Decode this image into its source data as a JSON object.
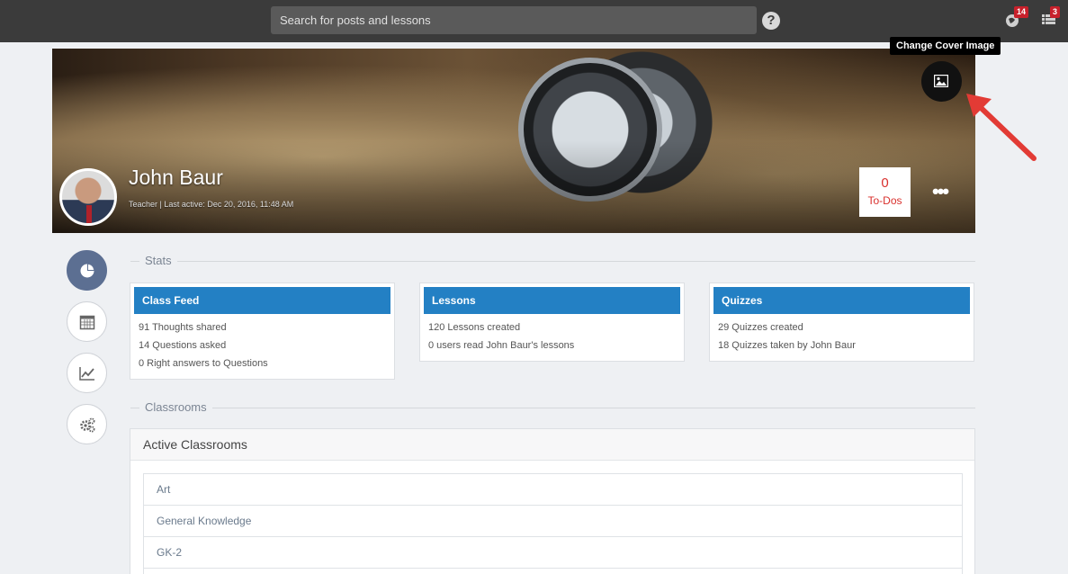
{
  "topbar": {
    "search_placeholder": "Search for posts and lessons",
    "help_label": "?",
    "notifications_count": "14",
    "tasks_count": "3"
  },
  "cover": {
    "tooltip": "Change Cover Image",
    "profile_name": "John Baur",
    "profile_meta": "Teacher | Last active: Dec 20, 2016, 11:48 AM",
    "todos_count": "0",
    "todos_label": "To-Dos",
    "more_label": "•••"
  },
  "side_nav": [
    {
      "icon": "pie-chart-icon",
      "active": true
    },
    {
      "icon": "calendar-icon",
      "active": false
    },
    {
      "icon": "line-chart-icon",
      "active": false
    },
    {
      "icon": "gears-icon",
      "active": false
    }
  ],
  "stats": {
    "heading": "Stats",
    "cards": [
      {
        "title": "Class Feed",
        "lines": [
          "91 Thoughts shared",
          "14 Questions asked",
          "0 Right answers to Questions"
        ]
      },
      {
        "title": "Lessons",
        "lines": [
          "120 Lessons created",
          "0 users read John Baur's lessons"
        ]
      },
      {
        "title": "Quizzes",
        "lines": [
          "29 Quizzes created",
          "18 Quizzes taken by John Baur"
        ]
      }
    ]
  },
  "classrooms": {
    "heading": "Classrooms",
    "panel_title": "Active Classrooms",
    "items": [
      "Art",
      "General Knowledge",
      "GK-2",
      ""
    ]
  },
  "colors": {
    "topbar": "#3b3b3b",
    "card_header": "#2380c4",
    "todos_red": "#d9302d",
    "arrow_red": "#e23b35",
    "active_nav": "#5c6f92"
  }
}
